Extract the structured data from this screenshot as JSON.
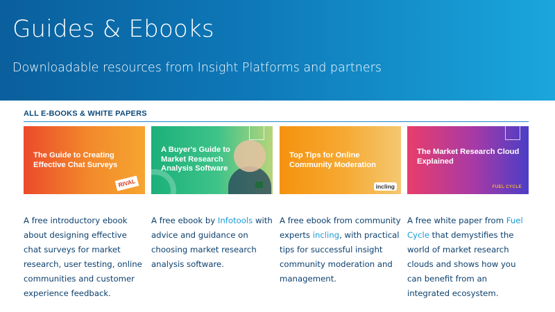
{
  "hero": {
    "title": "Guides & Ebooks",
    "subtitle": "Downloadable resources from Insight Platforms and partners"
  },
  "section": {
    "heading": "ALL E-BOOKS & WHITE PAPERS"
  },
  "cards": [
    {
      "thumb_title": "The Guide to Creating Effective Chat Surveys",
      "logo_text": "RIVAL",
      "desc_before": "A free introductory ebook about designing effective chat surveys for market research, user testing, online communities and customer experience feedback.",
      "link": "",
      "desc_after": ""
    },
    {
      "thumb_title": "A Buyer's Guide to Market Research Analysis Software",
      "logo_text": "",
      "desc_before": "A free ebook by ",
      "link": "Infotools",
      "desc_after": " with advice and guidance on choosing market research analysis software."
    },
    {
      "thumb_title": "Top Tips for Online Community Moderation",
      "logo_text": "incling",
      "desc_before": "A free ebook from community experts ",
      "link": "incling",
      "desc_after": ", with practical tips for successful insight community moderation and management."
    },
    {
      "thumb_title": "The Market Research Cloud Explained",
      "logo_text": "FUEL CYCLE",
      "desc_before": "A free white paper from ",
      "link": "Fuel Cycle",
      "desc_after": " that demystifies the world of market research clouds and shows how you can benefit from an integrated ecosystem."
    }
  ],
  "colors": {
    "hero_start": "#0a5f9c",
    "hero_end": "#1aa6dc",
    "heading": "#0c4a7a",
    "body_text": "#0b3f6d",
    "link": "#1a9bd7"
  }
}
